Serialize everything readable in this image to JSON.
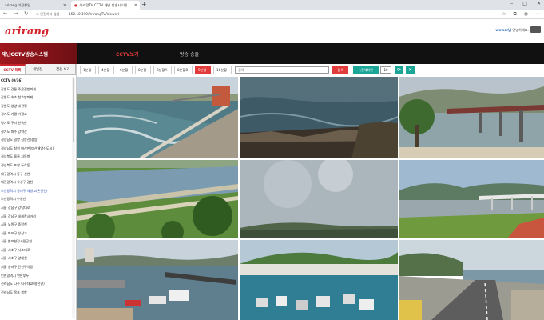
{
  "browser": {
    "tabs": [
      {
        "title": "arirang 이전창일",
        "active": false
      },
      {
        "title": "아리랑TV CCTV 재난 방송시스템",
        "active": true
      }
    ],
    "address": {
      "security": "안전하지 않음",
      "url": "150.10.190/ArirangTV/Viewer/"
    }
  },
  "header": {
    "logo": "arirang",
    "user_name": "viewer님",
    "user_greeting": "안녕하세요."
  },
  "nav": {
    "system_title": "재난CCTV방송시스템",
    "items": [
      "CCTV보기",
      "방송 송출"
    ]
  },
  "sidebar": {
    "tabs": [
      "CCTV 목록",
      "채널정",
      "점검 보기"
    ],
    "items": [
      {
        "label": "CCTV (0/36)",
        "type": "heading"
      },
      {
        "label": "강원도 강릉 주문진방파제",
        "type": "normal"
      },
      {
        "label": "강원도 속초 청호방파제",
        "type": "normal"
      },
      {
        "label": "강원도 양양 대관령",
        "type": "normal"
      },
      {
        "label": "경기도 가평 가평교",
        "type": "normal"
      },
      {
        "label": "경기도 구리 한속한",
        "type": "normal"
      },
      {
        "label": "경기도 파주 강약산",
        "type": "normal"
      },
      {
        "label": "경상남도 일양 삼랑진(중앙)",
        "type": "normal"
      },
      {
        "label": "경상남도 창원 마산만(마산해양신도시)",
        "type": "normal"
      },
      {
        "label": "경상북도 울릉 저동항",
        "type": "normal"
      },
      {
        "label": "경상북도 포항 두호동",
        "type": "normal"
      },
      {
        "label": "대구광역시 동구 신천",
        "type": "normal"
      },
      {
        "label": "대전광역시 유성구 갑천",
        "type": "normal"
      },
      {
        "label": "부산광역시 동래구 세병교(온천천)",
        "type": "highlight"
      },
      {
        "label": "부산광역시 수영만",
        "type": "normal"
      },
      {
        "label": "서울 강남구 강남대로",
        "type": "normal"
      },
      {
        "label": "서울 강남구 테헤란사거리",
        "type": "normal"
      },
      {
        "label": "서울 노원구 중랑천",
        "type": "normal"
      },
      {
        "label": "서울 마포구 성산교",
        "type": "normal"
      },
      {
        "label": "서울 반포한강시민공원",
        "type": "normal"
      },
      {
        "label": "서울 서초구 서초대로",
        "type": "normal"
      },
      {
        "label": "서울 서초구 양재천",
        "type": "normal"
      },
      {
        "label": "서울 송파구 탄천주차장",
        "type": "normal"
      },
      {
        "label": "인천광역시 연안부두",
        "type": "normal"
      },
      {
        "label": "전라남도 나주 나주대교(영산강)",
        "type": "normal"
      },
      {
        "label": "전라남도 목포 북항",
        "type": "normal"
      }
    ]
  },
  "toolbar": {
    "layouts": [
      {
        "label": "1분할",
        "active": false
      },
      {
        "label": "4분할",
        "active": false
      },
      {
        "label": "6분할",
        "active": false
      },
      {
        "label": "8분할",
        "active": false
      },
      {
        "label": "8분할A",
        "active": false
      },
      {
        "label": "8분할B",
        "active": false
      },
      {
        "label": "9분할",
        "active": true
      },
      {
        "label": "16분할",
        "active": false
      }
    ],
    "search_placeholder": "검색",
    "search_button": "검색",
    "interval_label": "전체화면",
    "interval_value": "10",
    "icons": [
      "expand-icon",
      "close-icon"
    ]
  },
  "cameras": [
    {
      "scene": "coast-breakwater"
    },
    {
      "scene": "rocky-sea"
    },
    {
      "scene": "bridge-river"
    },
    {
      "scene": "riverside-park"
    },
    {
      "scene": "foggy-sky"
    },
    {
      "scene": "mountain-bridge"
    },
    {
      "scene": "harbor-boats"
    },
    {
      "scene": "fishing-port"
    },
    {
      "scene": "coastal-road"
    }
  ],
  "colors": {
    "brand_red": "#d3242b",
    "active_red": "#e23b3b",
    "teal": "#1ba597",
    "nav_black": "#111111"
  }
}
